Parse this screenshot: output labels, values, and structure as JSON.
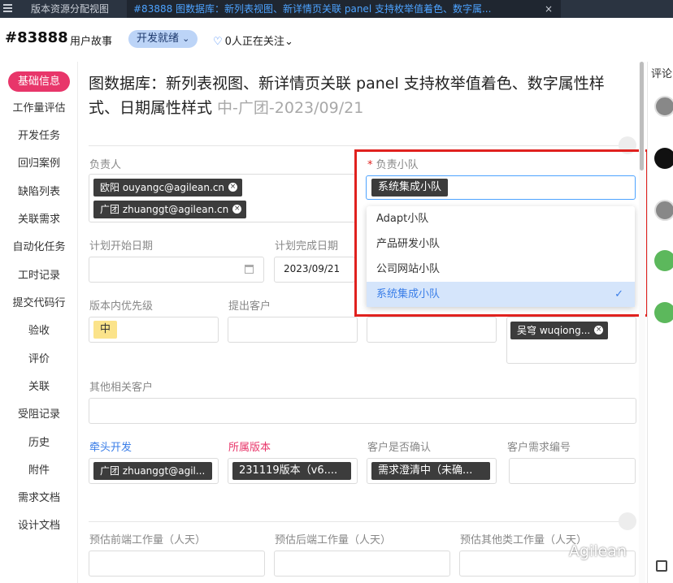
{
  "tabs": [
    {
      "label": "版本资源分配视图",
      "active": false
    },
    {
      "label": "#83888 图数据库：新列表视图、新详情页关联 panel 支持枚举值着色、数字属...",
      "active": true,
      "close": "×"
    }
  ],
  "menu_icon": "hamburger-icon",
  "header": {
    "id": "#83888",
    "type": "用户故事",
    "status": "开发就绪",
    "status_chevron": "⌄",
    "follow": "0人正在关注",
    "follow_chevron": "⌄"
  },
  "sidebar": {
    "items": [
      {
        "label": "基础信息",
        "active": true
      },
      {
        "label": "工作量评估"
      },
      {
        "label": "开发任务"
      },
      {
        "label": "回归案例"
      },
      {
        "label": "缺陷列表"
      },
      {
        "label": "关联需求"
      },
      {
        "label": "自动化任务"
      },
      {
        "label": "工时记录"
      },
      {
        "label": "提交代码行"
      },
      {
        "label": "验收"
      },
      {
        "label": "评价"
      },
      {
        "label": "关联"
      },
      {
        "label": "受阻记录"
      },
      {
        "label": "历史"
      },
      {
        "label": "附件"
      },
      {
        "label": "需求文档"
      },
      {
        "label": "设计文档"
      }
    ]
  },
  "title": {
    "main": "图数据库：新列表视图、新详情页关联 panel 支持枚举值着色、数字属性样式、日期属性样式",
    "suffix": " 中-广团-2023/09/21"
  },
  "form": {
    "owner_label": "负责人",
    "owners": [
      "欧阳 ouyangc@agilean.cn",
      "广团 zhuanggt@agilean.cn"
    ],
    "team_required": "*",
    "team_label": "负责小队",
    "team_value": "系统集成小队",
    "start_label": "计划开始日期",
    "end_label": "计划完成日期",
    "end_value": "2023/09/21",
    "priority_label": "版本内优先级",
    "priority_value": "中",
    "client_label": "提出客户",
    "assignee_tag": "吴穹 wuqiong...",
    "other_clients_label": "其他相关客户",
    "lead_label": "牵头开发",
    "lead_value": "广团 zhuanggt@agil...",
    "version_label": "所属版本",
    "version_value": "231119版本（v6....",
    "confirm_label": "客户是否确认",
    "confirm_value": "需求澄清中（未确...",
    "req_no_label": "客户需求编号",
    "fe_label": "预估前端工作量（人天）",
    "be_label": "预估后端工作量（人天）",
    "other_label": "预估其他类工作量（人天）"
  },
  "dropdown": {
    "options": [
      "Adapt小队",
      "产品研发小队",
      "公司网站小队",
      "系统集成小队"
    ],
    "selected_index": 3,
    "check": "✓"
  },
  "right": {
    "comments_label": "评论"
  },
  "watermark": "Agilean",
  "colors": {
    "accent": "#e8366a",
    "link": "#3a7ee8",
    "highlight_box": "#e0211e"
  }
}
